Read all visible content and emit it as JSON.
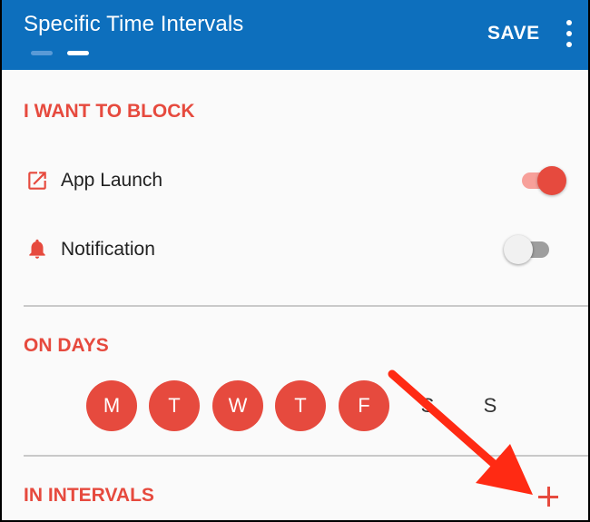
{
  "appbar": {
    "title": "Specific Time Intervals",
    "save_label": "SAVE",
    "menu_icon": "more-vert-icon",
    "page_indicator": {
      "count": 2,
      "active": 2
    }
  },
  "block_section": {
    "heading": "I WANT TO BLOCK",
    "items": [
      {
        "label": "App Launch",
        "icon": "open-in-new-icon",
        "enabled": true
      },
      {
        "label": "Notification",
        "icon": "bell-icon",
        "enabled": false
      }
    ]
  },
  "days_section": {
    "heading": "ON DAYS",
    "days": [
      {
        "label": "M",
        "selected": true
      },
      {
        "label": "T",
        "selected": true
      },
      {
        "label": "W",
        "selected": true
      },
      {
        "label": "T",
        "selected": true
      },
      {
        "label": "F",
        "selected": true
      },
      {
        "label": "S",
        "selected": false
      },
      {
        "label": "S",
        "selected": false
      }
    ]
  },
  "intervals_section": {
    "heading": "IN INTERVALS",
    "add_icon": "plus-icon"
  },
  "annotation": {
    "icon": "red-arrow-icon"
  },
  "colors": {
    "appbar": "#0d6fbd",
    "accent": "#e64a3e",
    "annotation": "#ff2a13"
  }
}
